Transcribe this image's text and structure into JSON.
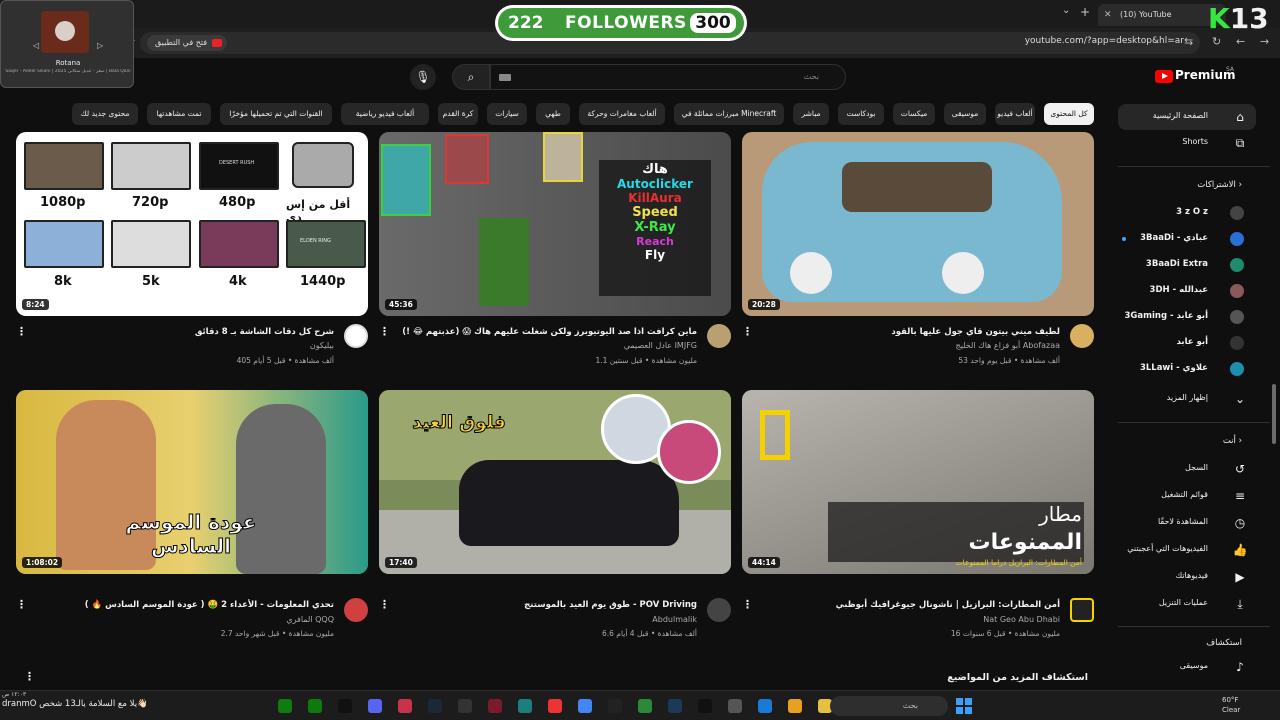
{
  "browser": {
    "tab_title": "(10) YouTube",
    "url": "youtube.com/?app=desktop&hl=ar",
    "open_in_app": "فتح في التطبيق"
  },
  "overlay": {
    "followers_left": "222",
    "followers_label": "FOLLOWERS",
    "followers_right": "300",
    "corner_k": "K",
    "corner_num": "13"
  },
  "rotana": {
    "title": "Rotana",
    "subtitle": "Saqer - Adeel Sikani | صقر - عديل سكاني 2025 | Bala Qani"
  },
  "header": {
    "logo": "Premium",
    "region": "SA",
    "search_placeholder": "بحث"
  },
  "chips": [
    "كل المحتوى",
    "ألعاب فيديو",
    "موسيقى",
    "ميكسات",
    "بودكاست",
    "مباشر",
    "مبرزات مماثلة في Minecraft",
    "ألعاب مغامرات وحركة",
    "طهي",
    "سيارات",
    "كرة القدم",
    "ألعاب فيديو رياضية",
    "القنوات التي تم تحميلها مؤخرًا",
    "تمت مشاهدتها",
    "محتوى جديد لك"
  ],
  "sidebar": {
    "home": "الصفحة الرئيسية",
    "shorts": "Shorts",
    "subscriptions": "الاشتراكات",
    "subs": [
      {
        "name": "3 z O z",
        "color": "#444"
      },
      {
        "name": "3BaaDi - عبادي",
        "color": "#2a6fd8"
      },
      {
        "name": "3BaaDi Extra",
        "color": "#1e8a6e"
      },
      {
        "name": "3DH - عبدالله",
        "color": "#8a5a5a"
      },
      {
        "name": "3Gaming - أبو عابد",
        "color": "#555"
      },
      {
        "name": "أبو عابد",
        "color": "#333"
      },
      {
        "name": "3LLawi - علاوي",
        "color": "#1a8fb0"
      }
    ],
    "show_more": "إظهار المزيد",
    "you": "أنت",
    "you_items": [
      "السجل",
      "قوائم التشغيل",
      "المشاهدة لاحقًا",
      "الفيديوهات التي أعجبتني",
      "فيديوهاتك",
      "عمليات التنزيل"
    ],
    "explore": "استكشاف",
    "music": "موسيقى"
  },
  "videos": [
    {
      "title": "شرح كل دقات الشاشة بـ 8 دقائق",
      "channel": "بيليكون",
      "meta": "405 ألف مشاهدة • قبل 5 أيام",
      "duration": "8:24"
    },
    {
      "title": "ماين كرافت اذا صد اليوتيوبرز ولكن شغلت عليهم هاك 😱 (عذبتهم 😂 !)",
      "channel": "عادل العصيمي IMJFG",
      "meta": "1.1 مليون مشاهدة • قبل سنتين",
      "duration": "45:36"
    },
    {
      "title": "لطيف ميني بيتون قاي جول عليها بالقود",
      "channel": "أبو فزاع هاك الخليج Abofazaa",
      "meta": "53 ألف مشاهدة • قبل يوم واحد",
      "duration": "20:28"
    },
    {
      "title": "تحدي المعلومات - الأعداء 2 🤑 ( عودة الموسم السادس 🔥 )",
      "channel": "المافري QQQ",
      "meta": "2.7 مليون مشاهدة • قبل شهر واحد",
      "duration": "1:08:02"
    },
    {
      "title": "طوق يوم العيد بالموستنج - POV Driving",
      "channel": "Abdulmalik",
      "meta": "6.6 ألف مشاهدة • قبل 4 أيام",
      "duration": "17:40"
    },
    {
      "title": "أمن المطارات: البرازيل | ناشونال جيوغرافيك أبوظبي",
      "channel": "Nat Geo Abu Dhabi",
      "meta": "16 مليون مشاهدة • قبل 6 سنوات",
      "duration": "44:14"
    }
  ],
  "thumb_text": {
    "res": [
      "1080p",
      "720p",
      "480p",
      "أقل من إس دي",
      "8k",
      "5k",
      "4k",
      "1440p"
    ],
    "hack_lines": [
      "هاك",
      "Autoclicker",
      "KillAura",
      "Speed",
      "X-Ray",
      "Reach",
      "Fly"
    ],
    "season": "عودة الموسم السادس",
    "eid": "فلوق العيد",
    "airport1": "مطار",
    "airport2": "الممنوعات",
    "airport3": "أمن المطارات: البرازيل دراما الممنوعات",
    "desert": "DESERT RUSH",
    "elden": "ELDEN RING"
  },
  "explore_more": "استكشاف المزيد من المواضيع",
  "taskbar": {
    "search": "بحث",
    "weather_temp": "60°F",
    "weather_desc": "Clear",
    "left_text": "dranmO يلا مع السلامة يالـ13 شخص👋🏻",
    "left_time": "١٢:٠٣ ص"
  }
}
